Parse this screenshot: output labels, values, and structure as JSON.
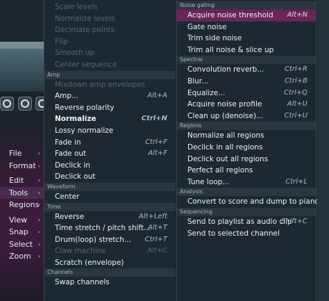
{
  "left_menu": [
    {
      "label": "File",
      "arrow": "›",
      "active": false
    },
    {
      "label": "Format",
      "arrow": "›",
      "active": false
    },
    {
      "label": "Edit",
      "arrow": "›",
      "active": false
    },
    {
      "label": "Tools",
      "arrow": "›",
      "active": true
    },
    {
      "label": "Regions",
      "arrow": "›",
      "active": false
    },
    {
      "label": "View",
      "arrow": "›",
      "active": false
    },
    {
      "label": "Snap",
      "arrow": "›",
      "active": false
    },
    {
      "label": "Select",
      "arrow": "›",
      "active": false
    },
    {
      "label": "Zoom",
      "arrow": "›",
      "active": false
    }
  ],
  "tools_menu": {
    "top_disabled": [
      "Scale levels",
      "Normalize levels",
      "Decimate points",
      "Flip",
      "Smooth up",
      "Center sequence"
    ],
    "sections": [
      {
        "header": "Amp",
        "items": [
          {
            "label": "Mixdown amp envelopes",
            "shortcut": "",
            "disabled": true
          },
          {
            "label": "Amp...",
            "shortcut": "Alt+A"
          },
          {
            "label": "Reverse polarity",
            "shortcut": ""
          },
          {
            "label": "Normalize",
            "shortcut": "Ctrl+N",
            "bold": true
          },
          {
            "label": "Lossy normalize",
            "shortcut": ""
          },
          {
            "label": "Fade in",
            "shortcut": "Ctrl+F"
          },
          {
            "label": "Fade out",
            "shortcut": "Alt+F"
          },
          {
            "label": "Declick in",
            "shortcut": ""
          },
          {
            "label": "Declick out",
            "shortcut": ""
          }
        ]
      },
      {
        "header": "Waveform",
        "items": [
          {
            "label": "Center",
            "shortcut": ""
          }
        ]
      },
      {
        "header": "Time",
        "items": [
          {
            "label": "Reverse",
            "shortcut": "Alt+Left"
          },
          {
            "label": "Time stretch / pitch shift...",
            "shortcut": "Alt+T"
          },
          {
            "label": "Drum(loop) stretch...",
            "shortcut": "Ctrl+T"
          },
          {
            "label": "Claw machine",
            "shortcut": "Alt+C",
            "disabled": true
          },
          {
            "label": "Scratch (envelope)",
            "shortcut": ""
          }
        ]
      },
      {
        "header": "Channels",
        "items": [
          {
            "label": "Swap channels",
            "shortcut": ""
          }
        ]
      }
    ]
  },
  "tools_submenu": {
    "sections": [
      {
        "header": "Noise gating",
        "items": [
          {
            "label": "Acquire noise threshold",
            "shortcut": "Alt+N",
            "highlighted": true
          },
          {
            "label": "Gate noise",
            "shortcut": ""
          },
          {
            "label": "Trim side noise",
            "shortcut": ""
          },
          {
            "label": "Trim all noise & slice up",
            "shortcut": ""
          }
        ]
      },
      {
        "header": "Spectral",
        "items": [
          {
            "label": "Convolution reverb...",
            "shortcut": "Ctrl+R"
          },
          {
            "label": "Blur...",
            "shortcut": "Ctrl+B"
          },
          {
            "label": "Equalize...",
            "shortcut": "Ctrl+Q"
          },
          {
            "label": "Acquire noise profile",
            "shortcut": "Alt+U"
          },
          {
            "label": "Clean up (denoise)...",
            "shortcut": "Ctrl+U"
          }
        ]
      },
      {
        "header": "Regions",
        "items": [
          {
            "label": "Normalize all regions",
            "shortcut": ""
          },
          {
            "label": "Declick in all regions",
            "shortcut": ""
          },
          {
            "label": "Declick out all regions",
            "shortcut": ""
          },
          {
            "label": "Perfect all regions",
            "shortcut": ""
          },
          {
            "label": "Tune loop...",
            "shortcut": "Ctrl+L"
          }
        ]
      },
      {
        "header": "Analysis",
        "items": [
          {
            "label": "Convert to score and dump to piano roll",
            "shortcut": ""
          }
        ]
      },
      {
        "header": "Sequencing",
        "items": [
          {
            "label": "Send to playlist as audio clip",
            "shortcut": "Shift+C"
          },
          {
            "label": "Send to selected channel",
            "shortcut": ""
          }
        ]
      }
    ]
  }
}
